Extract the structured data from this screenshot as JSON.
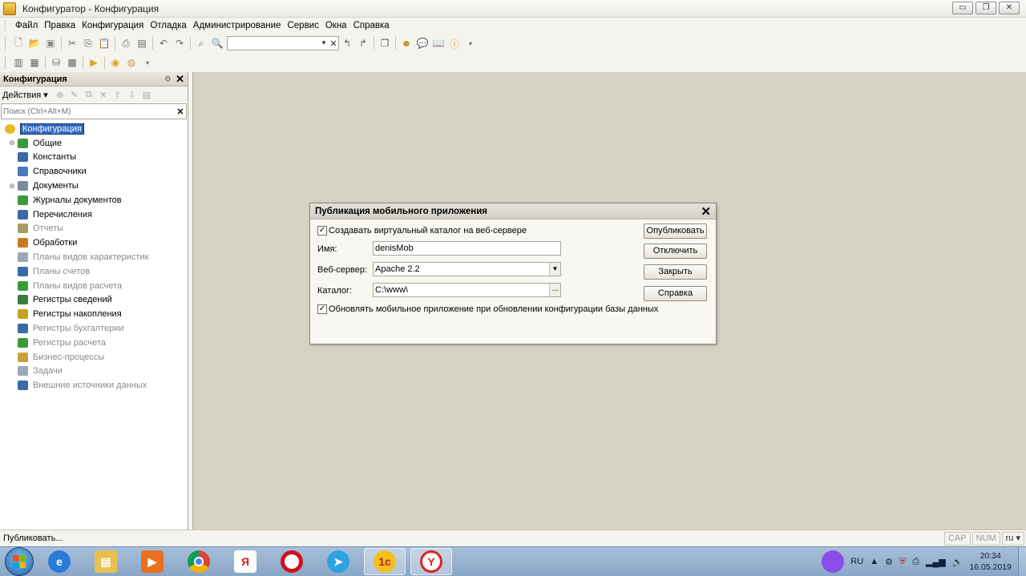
{
  "window": {
    "title": "Конфигуратор - Конфигурация",
    "buttons": [
      "▭",
      "❐",
      "✕"
    ]
  },
  "menu": [
    "Файл",
    "Правка",
    "Конфигурация",
    "Отладка",
    "Администрирование",
    "Сервис",
    "Окна",
    "Справка"
  ],
  "left_panel": {
    "title": "Конфигурация",
    "actions_label": "Действия ▾",
    "search_placeholder": "Поиск (Ctrl+Alt+M)",
    "tree": [
      {
        "label": "Конфигурация",
        "level": 0,
        "selected": true,
        "icon": "config-icon",
        "color": "#e8b820"
      },
      {
        "label": "Общие",
        "level": 1,
        "expandable": true,
        "icon": "common-icon",
        "color": "#3a9a3a"
      },
      {
        "label": "Константы",
        "level": 1,
        "icon": "constants-icon",
        "color": "#3a6aa8"
      },
      {
        "label": "Справочники",
        "level": 1,
        "icon": "catalogs-icon",
        "color": "#4a7ab8"
      },
      {
        "label": "Документы",
        "level": 1,
        "expandable": true,
        "icon": "documents-icon",
        "color": "#7a8aa0"
      },
      {
        "label": "Журналы документов",
        "level": 1,
        "icon": "journals-icon",
        "color": "#3a9a3a"
      },
      {
        "label": "Перечисления",
        "level": 1,
        "icon": "enums-icon",
        "color": "#3a6aa8"
      },
      {
        "label": "Отчеты",
        "level": 1,
        "dim": true,
        "icon": "reports-icon",
        "color": "#a89a60"
      },
      {
        "label": "Обработки",
        "level": 1,
        "icon": "processing-icon",
        "color": "#c87a20"
      },
      {
        "label": "Планы видов характеристик",
        "level": 1,
        "dim": true,
        "icon": "chart-char-icon",
        "color": "#9aa8b8"
      },
      {
        "label": "Планы счетов",
        "level": 1,
        "dim": true,
        "icon": "chart-accounts-icon",
        "color": "#3a6aa8"
      },
      {
        "label": "Планы видов расчета",
        "level": 1,
        "dim": true,
        "icon": "chart-calc-icon",
        "color": "#3a9a3a"
      },
      {
        "label": "Регистры сведений",
        "level": 1,
        "icon": "info-reg-icon",
        "color": "#3a7a3a"
      },
      {
        "label": "Регистры накопления",
        "level": 1,
        "icon": "accum-reg-icon",
        "color": "#c8a020"
      },
      {
        "label": "Регистры бухгалтерии",
        "level": 1,
        "dim": true,
        "icon": "acc-reg-icon",
        "color": "#3a6aa8"
      },
      {
        "label": "Регистры расчета",
        "level": 1,
        "dim": true,
        "icon": "calc-reg-icon",
        "color": "#3a9a3a"
      },
      {
        "label": "Бизнес-процессы",
        "level": 1,
        "dim": true,
        "icon": "bp-icon",
        "color": "#c8a040"
      },
      {
        "label": "Задачи",
        "level": 1,
        "dim": true,
        "icon": "tasks-icon",
        "color": "#9aa8b8"
      },
      {
        "label": "Внешние источники данных",
        "level": 1,
        "dim": true,
        "icon": "ext-src-icon",
        "color": "#3a6aa8"
      }
    ]
  },
  "dialog": {
    "title": "Публикация мобильного приложения",
    "create_virtual_dir": {
      "label": "Создавать виртуальный каталог на веб-сервере",
      "checked": true
    },
    "name_label": "Имя:",
    "name_value": "denisMob",
    "webserver_label": "Веб-сервер:",
    "webserver_value": "Apache 2.2",
    "dir_label": "Каталог:",
    "dir_value": "C:\\www\\",
    "dir_browse": "...",
    "update_on_db": {
      "label": "Обновлять мобильное приложение при обновлении конфигурации базы данных",
      "checked": true
    },
    "buttons": {
      "publish": "Опубликовать",
      "disable": "Отключить",
      "close": "Закрыть",
      "help": "Справка"
    }
  },
  "status": {
    "message": "Публиковать...",
    "caps": "CAP",
    "num": "NUM",
    "lang": "ru ▾"
  },
  "taskbar": {
    "lang": "RU",
    "time": "20:34",
    "date": "16.05.2019"
  }
}
